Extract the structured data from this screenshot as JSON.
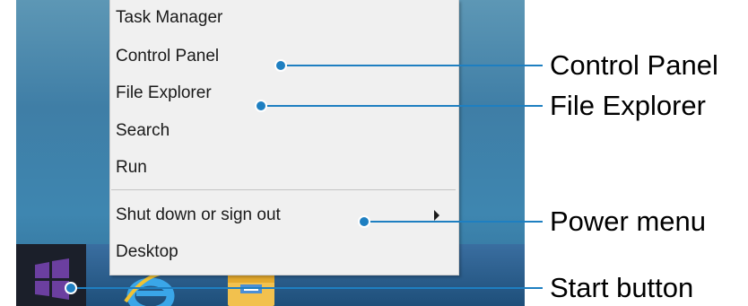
{
  "context_menu": {
    "items": [
      {
        "label": "Task Manager"
      },
      {
        "label": "Control Panel"
      },
      {
        "label": "File Explorer"
      },
      {
        "label": "Search"
      },
      {
        "label": "Run"
      },
      {
        "label": "Shut down or sign out",
        "has_submenu": true
      },
      {
        "label": "Desktop"
      }
    ]
  },
  "taskbar": {
    "icons": [
      "windows-logo-icon",
      "internet-explorer-icon",
      "file-explorer-icon"
    ]
  },
  "callouts": [
    {
      "label": "Control Panel"
    },
    {
      "label": "File Explorer"
    },
    {
      "label": "Power menu"
    },
    {
      "label": "Start button"
    }
  ],
  "colors": {
    "callout_line": "#1e7fc1",
    "start_logo": "#6b3fa0",
    "menu_background": "#f0f0f0",
    "desktop_background": "#3f7ea6"
  }
}
